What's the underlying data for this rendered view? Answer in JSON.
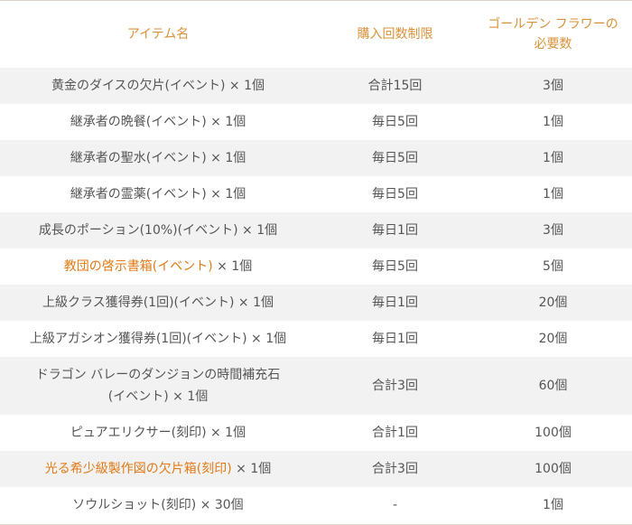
{
  "headers": {
    "item": "アイテム名",
    "limit": "購入回数制限",
    "cost_line1": "ゴールデン フラワーの",
    "cost_line2": "必要数"
  },
  "rows": [
    {
      "name": "黄金のダイスの欠片(イベント)",
      "name2": "",
      "qty": " × 1個",
      "limit": "合計15回",
      "cost": "3個",
      "highlight": false
    },
    {
      "name": "継承者の晩餐(イベント)",
      "name2": "",
      "qty": " × 1個",
      "limit": "毎日5回",
      "cost": "1個",
      "highlight": false
    },
    {
      "name": "継承者の聖水(イベント)",
      "name2": "",
      "qty": " × 1個",
      "limit": "毎日5回",
      "cost": "1個",
      "highlight": false
    },
    {
      "name": "継承者の霊薬(イベント)",
      "name2": "",
      "qty": " × 1個",
      "limit": "毎日5回",
      "cost": "1個",
      "highlight": false
    },
    {
      "name": "成長のポーション(10%)(イベント)",
      "name2": "",
      "qty": " × 1個",
      "limit": "毎日1回",
      "cost": "3個",
      "highlight": false
    },
    {
      "name": "教団の啓示書箱(イベント)",
      "name2": "",
      "qty": " × 1個",
      "limit": "毎日5回",
      "cost": "5個",
      "highlight": true
    },
    {
      "name": "上級クラス獲得券(1回)(イベント)",
      "name2": "",
      "qty": " × 1個",
      "limit": "毎日1回",
      "cost": "20個",
      "highlight": false
    },
    {
      "name": "上級アガシオン獲得券(1回)(イベント)",
      "name2": "",
      "qty": " × 1個",
      "limit": "毎日1回",
      "cost": "20個",
      "highlight": false
    },
    {
      "name": "ドラゴン バレーのダンジョンの時間補充石",
      "name2": "(イベント)",
      "qty": " × 1個",
      "limit": "合計3回",
      "cost": "60個",
      "highlight": false
    },
    {
      "name": "ピュアエリクサー(刻印)",
      "name2": "",
      "qty": " × 1個",
      "limit": "合計1回",
      "cost": "100個",
      "highlight": false
    },
    {
      "name": "光る希少級製作図の欠片箱(刻印)",
      "name2": "",
      "qty": " × 1個",
      "limit": "合計3回",
      "cost": "100個",
      "highlight": true
    },
    {
      "name": "ソウルショット(刻印)",
      "name2": "",
      "qty": " × 30個",
      "limit": "-",
      "cost": "1個",
      "highlight": false
    }
  ]
}
